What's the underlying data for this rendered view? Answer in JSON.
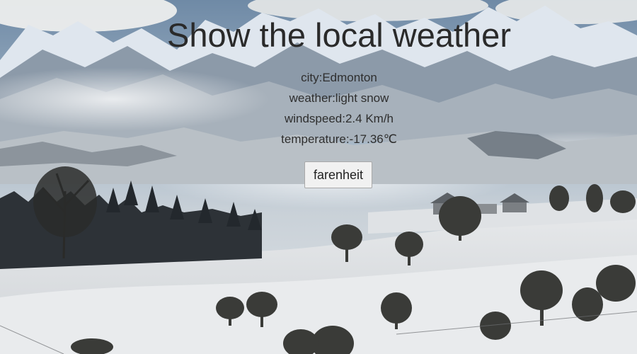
{
  "page": {
    "title": "Show the local weather"
  },
  "weather": {
    "city_line": "city:Edmonton",
    "weather_line": "weather:light snow",
    "wind_line": "windspeed:2.4 Km/h",
    "temp_line": "temperature:-17.36℃"
  },
  "controls": {
    "unit_button_label": "farenheit"
  }
}
